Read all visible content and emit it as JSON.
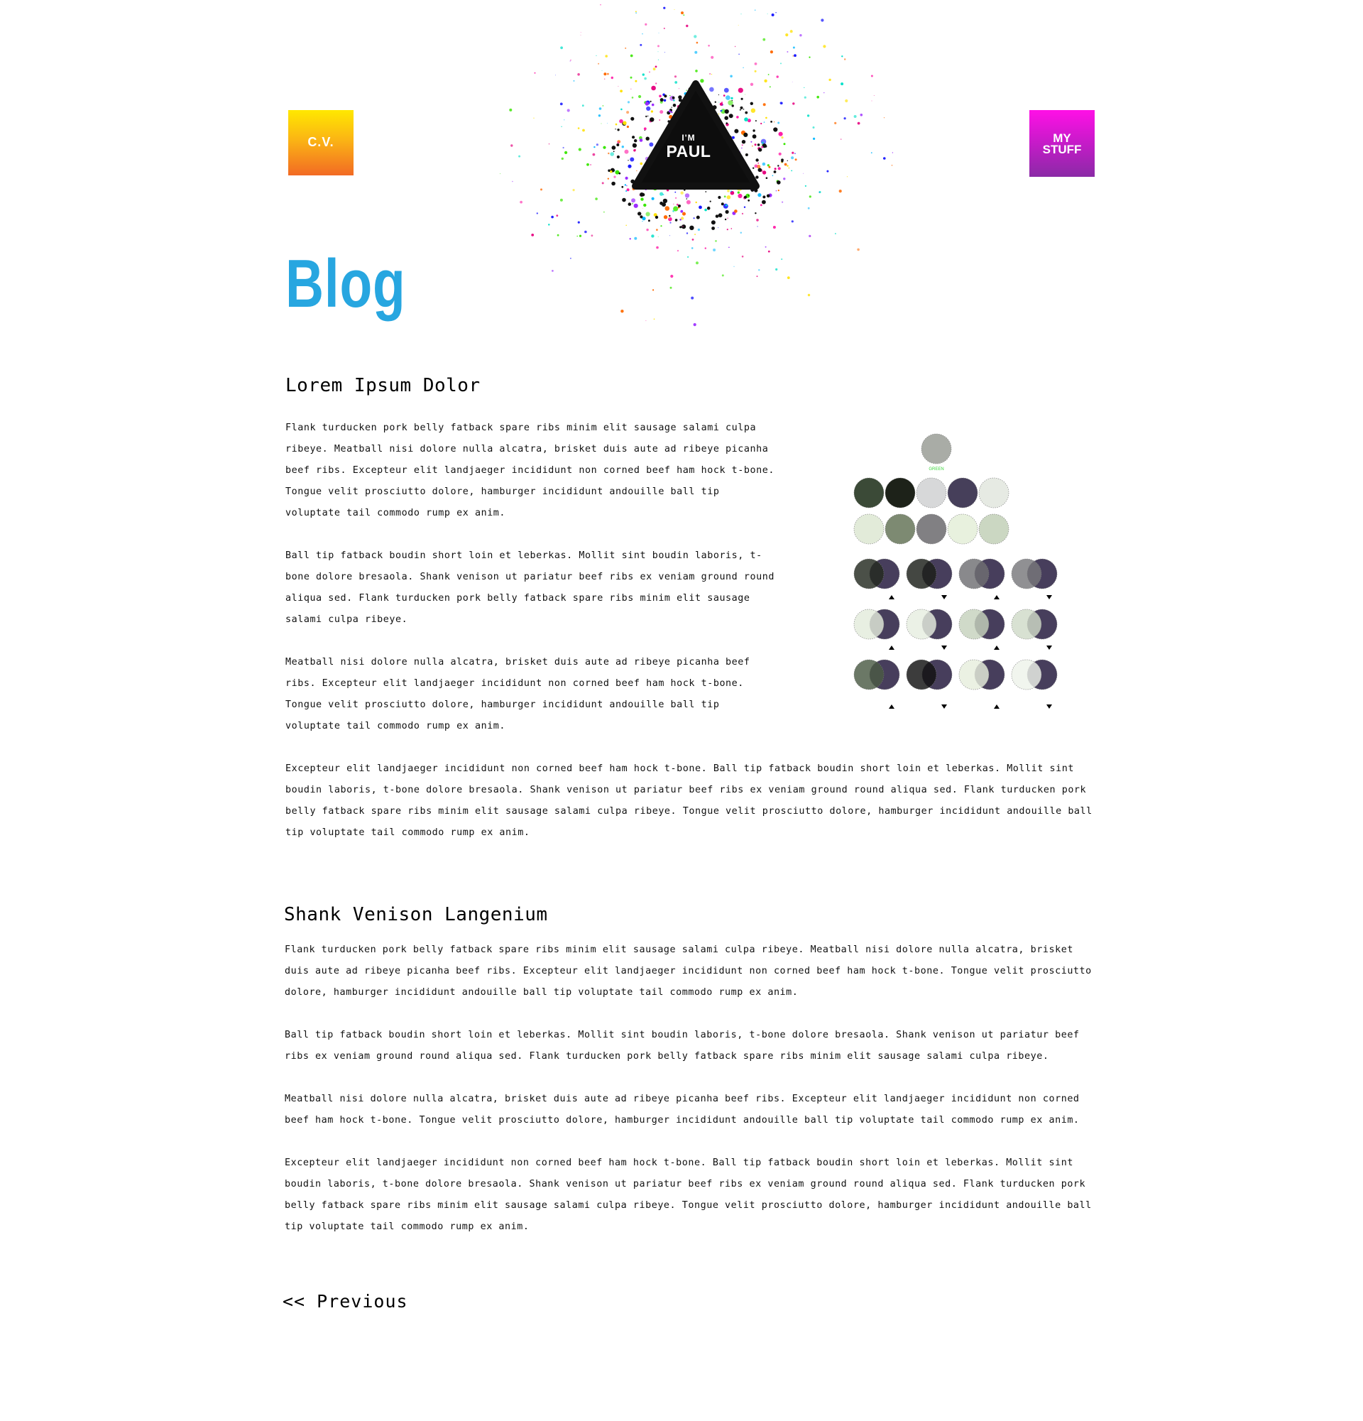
{
  "nav": {
    "cv_label": "C.V.",
    "stuff_label_line1": "My",
    "stuff_label_line2": "Stuff"
  },
  "logo": {
    "line1": "I'm",
    "line2": "Paul"
  },
  "page_title": "Blog",
  "posts": [
    {
      "title": "Lorem Ipsum Dolor",
      "paragraphs": [
        "Flank turducken pork belly fatback spare ribs minim elit sausage salami culpa ribeye. Meatball nisi dolore nulla alcatra, brisket duis aute ad ribeye picanha beef ribs. Excepteur elit landjaeger incididunt non corned beef ham hock t-bone. Tongue velit prosciutto dolore, hamburger incididunt andouille ball tip voluptate tail commodo rump ex anim.",
        "Ball tip fatback boudin short loin et leberkas. Mollit sint boudin laboris, t-bone dolore bresaola. Shank venison ut pariatur beef ribs ex veniam ground round aliqua sed. Flank turducken pork belly fatback spare ribs minim elit sausage salami culpa ribeye.",
        "Meatball nisi dolore nulla alcatra, brisket duis aute ad ribeye picanha beef ribs. Excepteur elit landjaeger incididunt non corned beef ham hock t-bone. Tongue velit prosciutto dolore, hamburger incididunt andouille ball tip voluptate tail commodo rump ex anim.",
        "Excepteur elit landjaeger incididunt non corned beef ham hock t-bone. Ball tip fatback boudin short loin et leberkas. Mollit sint boudin laboris, t-bone dolore bresaola. Shank venison ut pariatur beef ribs ex veniam ground round aliqua sed. Flank turducken pork belly fatback spare ribs minim elit sausage salami culpa ribeye. Tongue velit prosciutto dolore, hamburger incididunt andouille ball tip voluptate tail commodo rump ex anim."
      ]
    },
    {
      "title": "Shank Venison Langenium",
      "paragraphs": [
        "Flank turducken pork belly fatback spare ribs minim elit sausage salami culpa ribeye. Meatball nisi dolore nulla alcatra, brisket duis aute ad ribeye picanha beef ribs. Excepteur elit landjaeger incididunt non corned beef ham hock t-bone. Tongue velit prosciutto dolore, hamburger incididunt andouille ball tip voluptate tail commodo rump ex anim.",
        "Ball tip fatback boudin short loin et leberkas. Mollit sint boudin laboris, t-bone dolore bresaola. Shank venison ut pariatur beef ribs ex veniam ground round aliqua sed. Flank turducken pork belly fatback spare ribs minim elit sausage salami culpa ribeye.",
        "Meatball nisi dolore nulla alcatra, brisket duis aute ad ribeye picanha beef ribs. Excepteur elit landjaeger incididunt non corned beef ham hock t-bone. Tongue velit prosciutto dolore, hamburger incididunt andouille ball tip voluptate tail commodo rump ex anim.",
        "Excepteur elit landjaeger incididunt non corned beef ham hock t-bone. Ball tip fatback boudin short loin et leberkas. Mollit sint boudin laboris, t-bone dolore bresaola. Shank venison ut pariatur beef ribs ex veniam ground round aliqua sed. Flank turducken pork belly fatback spare ribs minim elit sausage salami culpa ribeye. Tongue velit prosciutto dolore, hamburger incididunt andouille ball tip voluptate tail commodo rump ex anim."
      ]
    }
  ],
  "figure": {
    "top_label": "GREEN"
  },
  "pagination": {
    "previous_label": "<< Previous"
  },
  "colors": {
    "accent": "#27a6e0",
    "cv_tile_top": "#ffe800",
    "cv_tile_bottom": "#f26a24",
    "stuff_tile_top": "#ff10e6",
    "stuff_tile_bottom": "#8a2aa6",
    "text": "#111111"
  },
  "icons": {
    "logo": "paint-splash-triangle-icon"
  }
}
